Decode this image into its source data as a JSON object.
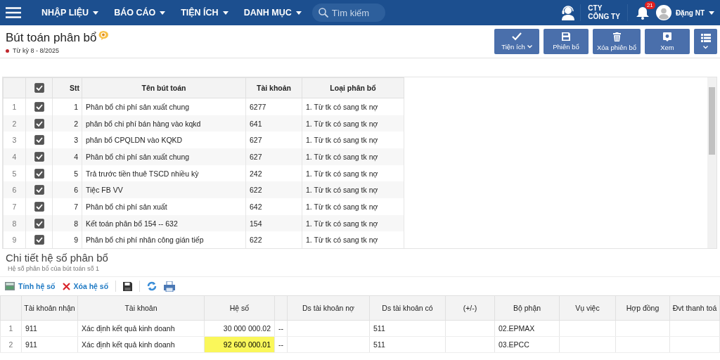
{
  "nav": {
    "menus": [
      {
        "label": "NHẬP LIỆU"
      },
      {
        "label": "BÁO CÁO"
      },
      {
        "label": "TIỆN ÍCH"
      },
      {
        "label": "DANH MỤC"
      }
    ],
    "search": {
      "placeholder": "Tìm kiếm"
    },
    "company": {
      "line1": "CTY",
      "line2": "CÔNG TY"
    },
    "notifications": "21",
    "user": "Đặng NT"
  },
  "page": {
    "title": "Bút toán phân bổ",
    "period": "Từ kỳ 8 - 8/2025"
  },
  "actions": [
    {
      "kind": "check",
      "label": "Tiện ích",
      "dropdown": true
    },
    {
      "kind": "save",
      "label": "Phiên bổ",
      "dropdown": false
    },
    {
      "kind": "trash",
      "label": "Xóa phiên bổ",
      "dropdown": false
    },
    {
      "kind": "view",
      "label": "Xem",
      "dropdown": false
    },
    {
      "kind": "list",
      "dropdown": true
    }
  ],
  "entries": {
    "all_checked": true,
    "columns": [
      "Stt",
      "Tên bút toán",
      "Tài khoản",
      "Loại phân bổ"
    ],
    "rows": [
      {
        "row": "1",
        "checked": true,
        "stt": "1",
        "name": "Phân bổ chi phí sản xuất chung",
        "account": "6277",
        "type": "1. Từ tk có sang tk nợ"
      },
      {
        "row": "2",
        "checked": true,
        "stt": "2",
        "name": "phân bổ chi phí bán hàng vào kqkd",
        "account": "641",
        "type": "1. Từ tk có sang tk nợ"
      },
      {
        "row": "3",
        "checked": true,
        "stt": "3",
        "name": "phân bổ CPQLDN vào KQKD",
        "account": "627",
        "type": "1. Từ tk có sang tk nợ"
      },
      {
        "row": "4",
        "checked": true,
        "stt": "4",
        "name": "Phân bổ chi phí sản xuất chung",
        "account": "627",
        "type": "1. Từ tk có sang tk nợ"
      },
      {
        "row": "5",
        "checked": true,
        "stt": "5",
        "name": "Trả trước tiền thuê TSCD nhiều kỳ",
        "account": "242",
        "type": "1. Từ tk có sang tk nợ"
      },
      {
        "row": "6",
        "checked": true,
        "stt": "6",
        "name": "Tiệc FB VV",
        "account": "622",
        "type": "1. Từ tk có sang tk nợ"
      },
      {
        "row": "7",
        "checked": true,
        "stt": "7",
        "name": "Phân bổ chi phí sản xuất",
        "account": "642",
        "type": "1. Từ tk có sang tk nợ"
      },
      {
        "row": "8",
        "checked": true,
        "stt": "8",
        "name": "Kết toán phân bổ 154 -- 632",
        "account": "154",
        "type": "1. Từ tk có sang tk nợ"
      },
      {
        "row": "9",
        "checked": true,
        "stt": "9",
        "name": "Phân bổ chi phí nhân công gián tiếp",
        "account": "622",
        "type": "1. Từ tk có sang tk nợ"
      }
    ]
  },
  "detail": {
    "title": "Chi tiết hệ số phân bổ",
    "subtitle": "Hệ số phân bổ của bút toán số 1",
    "tools": [
      {
        "kind": "calc",
        "label": "Tính hệ số"
      },
      {
        "kind": "delete",
        "label": "Xóa hệ số"
      },
      {
        "kind": "save"
      },
      {
        "kind": "refresh"
      },
      {
        "kind": "print"
      }
    ],
    "columns": [
      "Tài khoản nhận",
      "Tài khoản",
      "Hệ số",
      "",
      "Ds tài khoản nợ",
      "Ds tài khoản có",
      "(+/-)",
      "Bộ phận",
      "Vụ việc",
      "Hợp đồng",
      "Đvt thanh toá"
    ],
    "rows": [
      {
        "row": "1",
        "cells": [
          "911",
          "Xác định kết quả kinh doanh",
          "30 000 000.02",
          "--",
          "",
          "511",
          "",
          "02.EPMAX",
          "",
          "",
          ""
        ],
        "highlighted": false
      },
      {
        "row": "2",
        "cells": [
          "911",
          "Xác định kết quả kinh doanh",
          "92 600 000.01",
          "--",
          "",
          "511",
          "",
          "03.EPCC",
          "",
          "",
          ""
        ],
        "highlighted": true
      }
    ]
  }
}
